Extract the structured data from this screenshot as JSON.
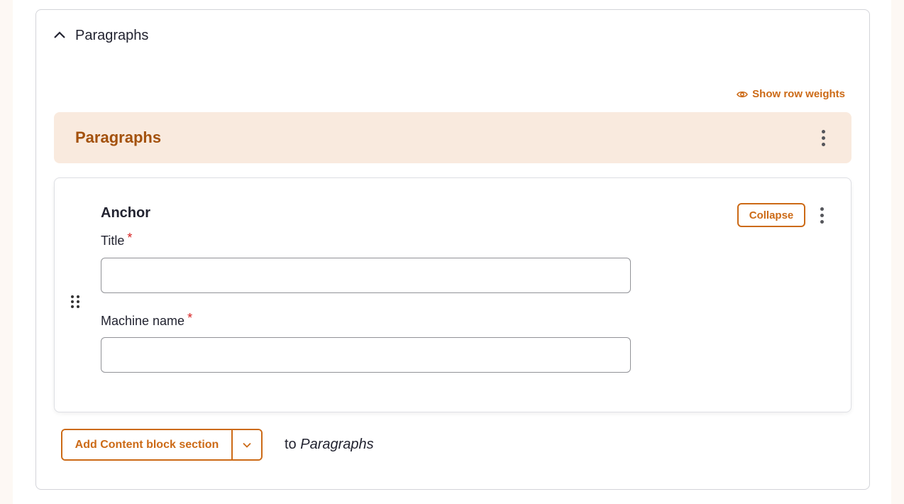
{
  "section": {
    "summary_label": "Paragraphs"
  },
  "table": {
    "show_row_weights": "Show row weights",
    "header_title": "Paragraphs"
  },
  "item": {
    "title": "Anchor",
    "collapse_label": "Collapse",
    "fields": [
      {
        "label": "Title",
        "required_marker": "*",
        "value": ""
      },
      {
        "label": "Machine name",
        "required_marker": "*",
        "value": ""
      }
    ]
  },
  "add": {
    "button_label": "Add Content block section",
    "to_prefix": "to",
    "to_target": "Paragraphs"
  },
  "colors": {
    "accent": "#cc6a16",
    "header_bg": "#f9eade",
    "header_text": "#a3510c",
    "required": "#d72222"
  },
  "icons": {
    "summary_toggle": "chevron-up-icon",
    "show_weights": "eye-icon",
    "row_menu": "kebab-icon",
    "drag": "drag-handle-icon",
    "dropdown": "chevron-down-icon"
  }
}
